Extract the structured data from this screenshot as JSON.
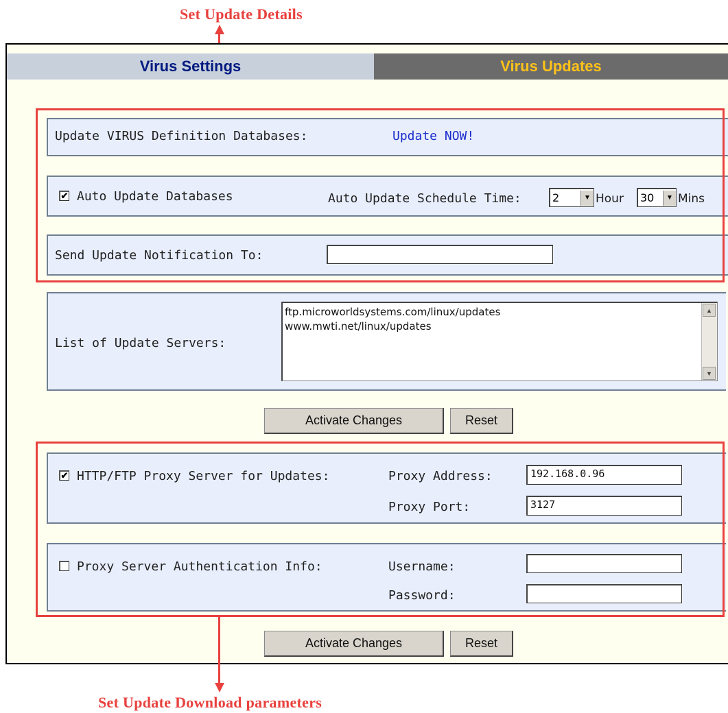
{
  "annotations": {
    "top": "Set Update Details",
    "bottom": "Set Update Download parameters"
  },
  "tabs": [
    {
      "label": "Virus Settings"
    },
    {
      "label": "Virus Updates"
    }
  ],
  "update_db": {
    "label": "Update VIRUS Definition Databases:",
    "link": "Update NOW!"
  },
  "auto_update": {
    "label": "Auto Update Databases",
    "checked": true,
    "check_mark": "✔",
    "schedule_label": "Auto Update Schedule Time:",
    "hour_value": "2",
    "hour_label": "Hour",
    "mins_value": "30",
    "mins_label": "Mins"
  },
  "notification": {
    "label": "Send Update Notification To:",
    "value": ""
  },
  "servers": {
    "label": "List of Update Servers:",
    "lines": [
      "ftp.microworldsystems.com/linux/updates",
      "www.mwti.net/linux/updates"
    ]
  },
  "buttons": {
    "activate": "Activate Changes",
    "reset": "Reset"
  },
  "proxy": {
    "label": "HTTP/FTP Proxy Server for Updates:",
    "checked": true,
    "check_mark": "✔",
    "address_label": "Proxy Address:",
    "address_value": "192.168.0.96",
    "port_label": "Proxy Port:",
    "port_value": "3127"
  },
  "auth": {
    "label": "Proxy Server Authentication Info:",
    "checked": false,
    "username_label": "Username:",
    "username_value": "",
    "password_label": "Password:",
    "password_value": ""
  },
  "colors": {
    "annotation": "#e8413e",
    "tab_active_text": "#001a80",
    "tab_inactive_text": "#ffc21a",
    "link": "#1a2dcc"
  }
}
